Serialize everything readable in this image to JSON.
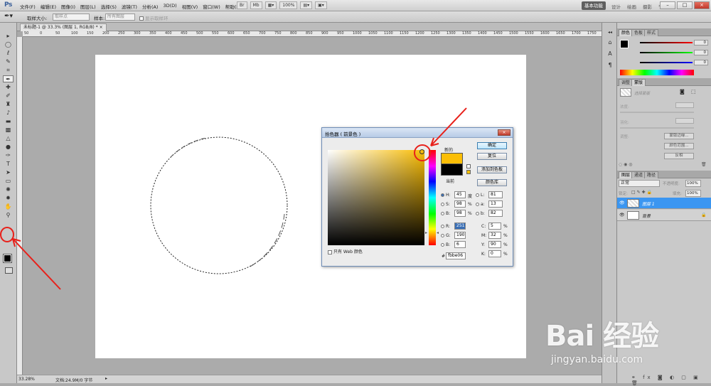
{
  "app": {
    "logo": "Ps",
    "menus": [
      "文件(F)",
      "编辑(E)",
      "图像(I)",
      "图层(L)",
      "选择(S)",
      "滤镜(T)",
      "分析(A)",
      "3D(D)",
      "视图(V)",
      "窗口(W)",
      "帮助(H)"
    ],
    "zoom_menu": "100%",
    "workspace_active": "基本功能",
    "workspace_links": [
      "设计",
      "绘画",
      "摄影"
    ]
  },
  "options_bar": {
    "sample_size_label": "取样大小:",
    "sample_size_value": "取样点",
    "sample_label": "样本:",
    "sample_value": "所有图层",
    "show_ring": "显示取样环"
  },
  "document": {
    "tab_title": "未标题-1 @ 33.3% (图层 1, RGB/8) *",
    "zoom": "33.28%",
    "doc_info": "文档:24.9M/0 字节",
    "ruler_ticks": [
      "50",
      "0",
      "50",
      "100",
      "150",
      "200",
      "250",
      "300",
      "350",
      "400",
      "450",
      "500",
      "550",
      "600",
      "650",
      "700",
      "750",
      "800",
      "850",
      "900",
      "950",
      "1000",
      "1050",
      "1100",
      "1150",
      "1200",
      "1250",
      "1300",
      "1350",
      "1400",
      "1450",
      "1500",
      "1550",
      "1600",
      "1650",
      "1700",
      "1750"
    ]
  },
  "color_picker": {
    "title": "拾色器 ( 前景色 )",
    "new_label": "新的",
    "current_label": "当前",
    "new_color": "#fbbe06",
    "current_color": "#000000",
    "buttons": {
      "ok": "确定",
      "reset": "复位",
      "add_swatch": "添加到色板",
      "libraries": "颜色库"
    },
    "hsb": {
      "h_label": "H:",
      "h": "45",
      "h_unit": "度",
      "s_label": "S:",
      "s": "98",
      "s_unit": "%",
      "b_label": "B:",
      "b": "98",
      "b_unit": "%"
    },
    "rgb": {
      "r_label": "R:",
      "r": "251",
      "g_label": "G:",
      "g": "190",
      "b_label": "B:",
      "b": "6"
    },
    "lab": {
      "l_label": "L:",
      "l": "81",
      "a_label": "a:",
      "a": "13",
      "b_label": "b:",
      "b": "82"
    },
    "cmyk": {
      "c_label": "C:",
      "c": "5",
      "m_label": "M:",
      "m": "32",
      "y_label": "Y:",
      "y": "90",
      "k_label": "K:",
      "k": "0",
      "unit": "%"
    },
    "hex_label": "#",
    "hex": "fbbe06",
    "web_only": "只有 Web 颜色"
  },
  "panels": {
    "color_tabs": [
      "颜色",
      "色板",
      "样式"
    ],
    "color_r": "0",
    "color_g": "0",
    "color_b": "0",
    "adjust_tabs": [
      "调整",
      "蒙版"
    ],
    "mask_label": "选择蒙版",
    "density_label": "浓度:",
    "feather_label": "羽化:",
    "refine_label": "调整:",
    "mask_buttons": [
      "蒙版边缘...",
      "颜色范围...",
      "反相"
    ],
    "layer_tabs": [
      "图层",
      "通道",
      "路径"
    ],
    "blend_mode": "正常",
    "opacity_label": "不透明度:",
    "opacity": "100%",
    "lock_label": "锁定:",
    "fill_label": "填充:",
    "fill": "100%",
    "layers": [
      {
        "name": "图层 1",
        "selected": true
      },
      {
        "name": "背景",
        "selected": false
      }
    ]
  },
  "watermark": {
    "brand": "Bai 经验",
    "url": "jingyan.baidu.com"
  }
}
